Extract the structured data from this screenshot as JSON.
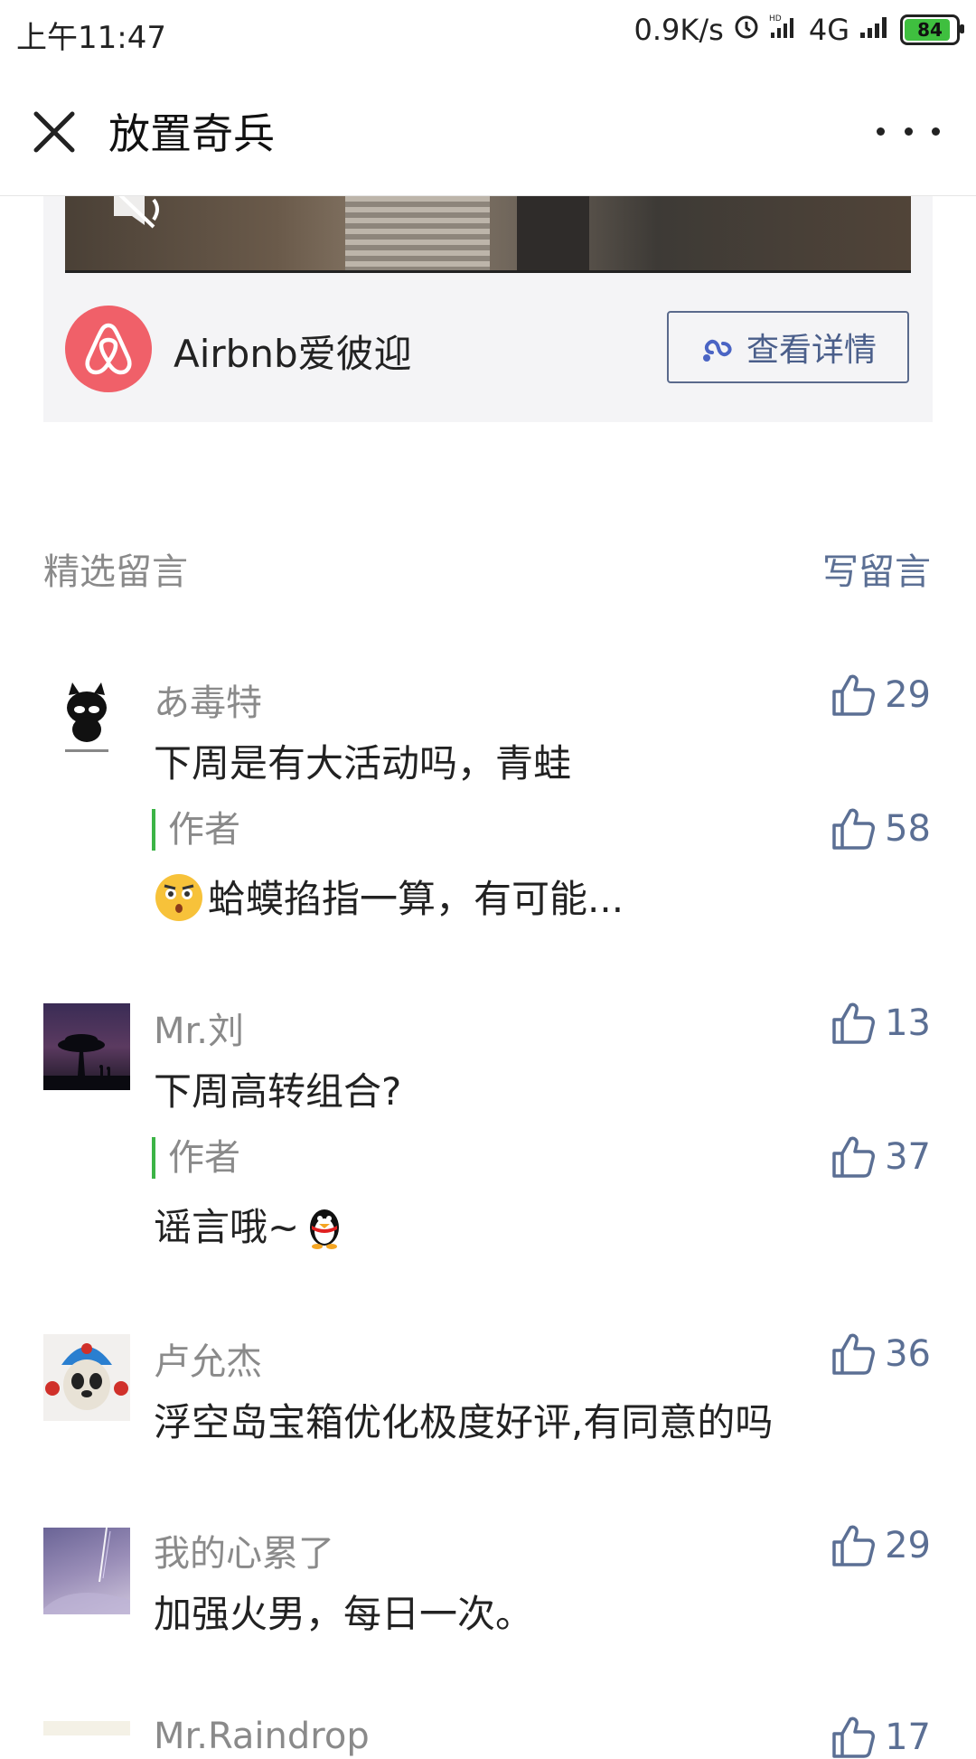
{
  "status_bar": {
    "time": "上午11:47",
    "net_speed": "0.9K/s",
    "network": "4G",
    "battery": "84"
  },
  "nav": {
    "title": "放置奇兵"
  },
  "ad": {
    "brand": "Airbnb爱彼迎",
    "button_label": "查看详情"
  },
  "comments_section": {
    "title": "精选留言",
    "write_label": "写留言"
  },
  "comments": [
    {
      "name": "あ毒特",
      "text": "下周是有大活动吗，青蛙",
      "likes": "29",
      "reply": {
        "tag": "作者",
        "text": "蛤蟆掐指一算，有可能...",
        "likes": "58"
      }
    },
    {
      "name": "Mr.刘",
      "text": "下周高转组合?",
      "likes": "13",
      "reply": {
        "tag": "作者",
        "text": "谣言哦~",
        "likes": "37"
      }
    },
    {
      "name": "卢允杰",
      "text": "浮空岛宝箱优化极度好评,有同意的吗",
      "likes": "36"
    },
    {
      "name": "我的心累了",
      "text": "加强火男，每日一次。",
      "likes": "29"
    },
    {
      "name": "Mr.Raindrop",
      "text": "",
      "likes": "17"
    }
  ]
}
